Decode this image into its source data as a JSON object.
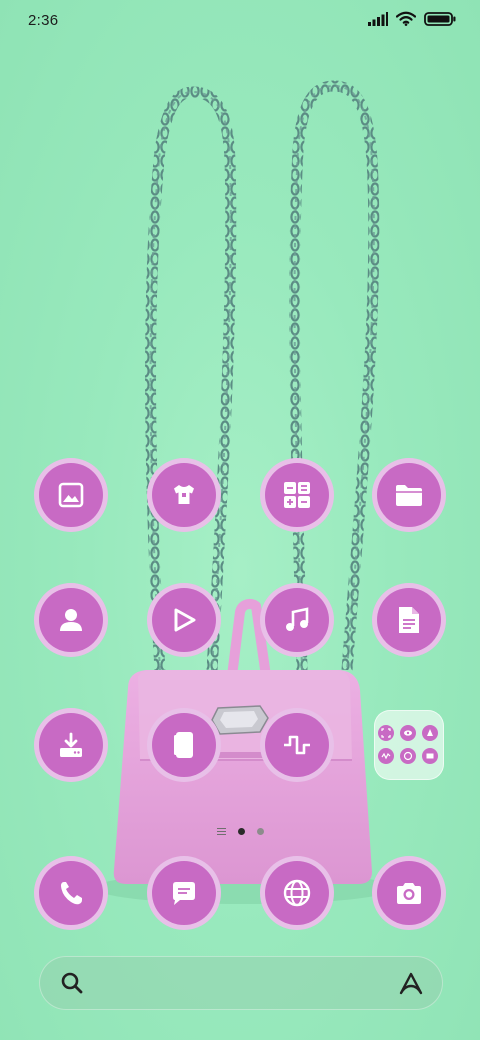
{
  "status_bar": {
    "time": "2:36",
    "icons": [
      "signal-icon",
      "wifi-icon",
      "battery-icon"
    ]
  },
  "wallpaper": {
    "subject": "pink-backpack-with-chain-straps",
    "colors": {
      "background": "#98e9bd",
      "bag": "#e7a2dc",
      "chain": "#5f8f86"
    }
  },
  "home": {
    "accent_color": "#c86ac4",
    "ring_color": "#e8c0e8",
    "apps": [
      {
        "icon": "gallery-icon"
      },
      {
        "icon": "theme-store-icon"
      },
      {
        "icon": "calculator-icon"
      },
      {
        "icon": "file-manager-icon"
      },
      {
        "icon": "contacts-icon"
      },
      {
        "icon": "video-player-icon"
      },
      {
        "icon": "music-icon"
      },
      {
        "icon": "notes-icon"
      },
      {
        "icon": "downloads-icon"
      },
      {
        "icon": "wallet-icon"
      },
      {
        "icon": "recorder-icon"
      },
      {
        "icon": "app-folder-icon"
      }
    ],
    "page_indicator": {
      "pages": 2,
      "current": 1
    }
  },
  "dock": [
    {
      "icon": "phone-icon"
    },
    {
      "icon": "messages-icon"
    },
    {
      "icon": "browser-icon"
    },
    {
      "icon": "camera-icon"
    }
  ],
  "search_bar": {
    "left_icon": "search-icon",
    "right_icon": "assistant-icon"
  }
}
